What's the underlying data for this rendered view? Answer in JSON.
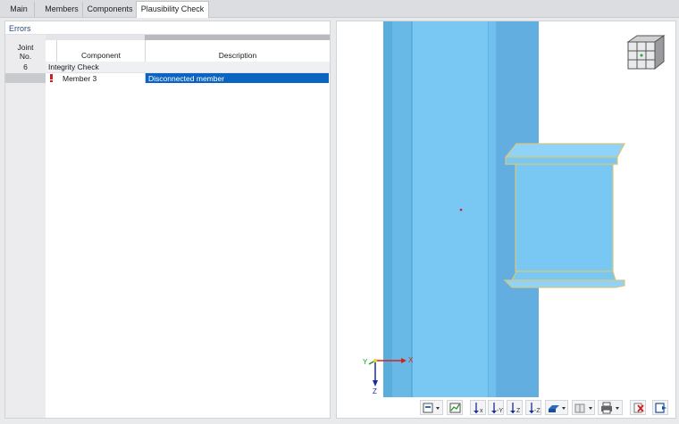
{
  "tabs": [
    {
      "label": "Main"
    },
    {
      "label": "Members"
    },
    {
      "label": "Components"
    },
    {
      "label": "Plausibility Check"
    }
  ],
  "errors_panel": {
    "title": "Errors",
    "columns": {
      "joint_no": "Joint\nNo.",
      "component": "Component",
      "description": "Description"
    },
    "group": {
      "joint_no": "6",
      "label": "Integrity Check"
    },
    "rows": [
      {
        "component": "Member 3",
        "description": "Disconnected member",
        "selected": true,
        "status_icon": "error-marker-icon"
      }
    ]
  },
  "view": {
    "axes": {
      "x": "X",
      "y": "Y",
      "z": "Z"
    },
    "nav_cube_icon": "view-cube-icon",
    "colors": {
      "member_fill": "#79c8f4",
      "member_edge": "#d8c57a",
      "x_axis": "#d62020",
      "y_axis": "#1c9a1c",
      "z_axis": "#1d2a9e",
      "highlight": "#0a64c0"
    }
  },
  "toolbar": [
    {
      "icon": "display-properties-icon",
      "dropdown": true
    },
    {
      "icon": "view-graph-icon"
    },
    {
      "icon": "view-x-icon"
    },
    {
      "icon": "view-neg-y-icon"
    },
    {
      "icon": "view-z-icon"
    },
    {
      "icon": "view-neg-z-icon"
    },
    {
      "icon": "rendering-mode-icon",
      "dropdown": true
    },
    {
      "icon": "transparency-icon",
      "dropdown": true
    },
    {
      "icon": "print-icon",
      "dropdown": true
    },
    {
      "icon": "reset-view-icon"
    },
    {
      "icon": "exit-view-icon"
    }
  ]
}
